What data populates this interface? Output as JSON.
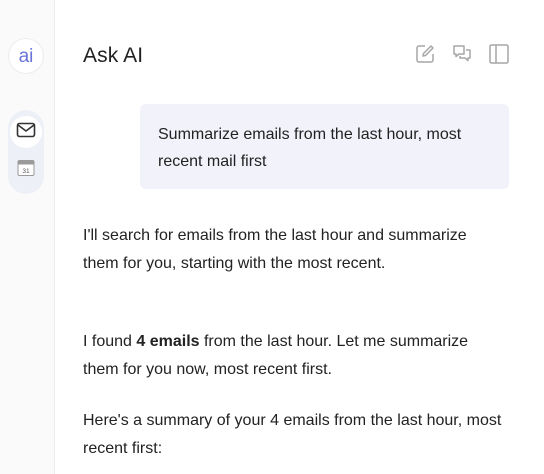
{
  "rail": {
    "ai_badge": "ai",
    "apps": [
      {
        "icon": "mail-icon"
      },
      {
        "icon": "calendar-icon",
        "label": "31"
      }
    ]
  },
  "header": {
    "title": "Ask AI",
    "actions": [
      {
        "icon": "edit-icon"
      },
      {
        "icon": "chat-bubbles-icon"
      },
      {
        "icon": "sidebar-panel-icon"
      }
    ]
  },
  "conversation": {
    "user_message": "Summarize emails from the last hour, most recent mail first",
    "assistant": {
      "p1": "I'll search for emails from the last hour and summarize them for you, starting with the most recent.",
      "p2_pre": "I found ",
      "p2_bold": "4 emails",
      "p2_post": " from the last hour. Let me summarize them for you now, most recent first.",
      "p3": "Here's a summary of your 4 emails from the last hour, most recent first:"
    }
  },
  "colors": {
    "accent": "#6a73d9",
    "user_bubble": "#f1f2fa",
    "rail_bg": "#fafafa"
  }
}
